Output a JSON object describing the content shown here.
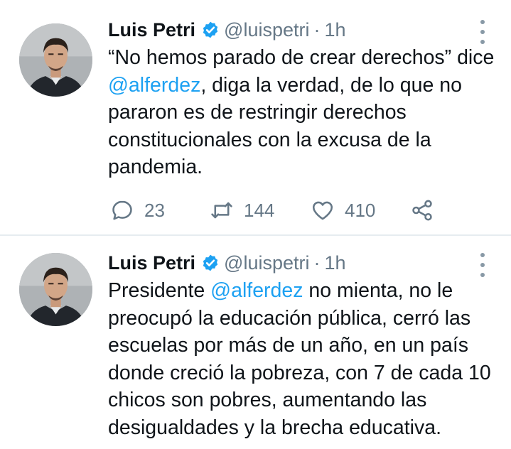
{
  "tweets": [
    {
      "author": "Luis Petri",
      "handle": "@luispetri",
      "separator": "·",
      "time": "1h",
      "text_before": "“No hemos parado de crear derechos” dice ",
      "mention": "@alferdez",
      "text_after": ", diga la verdad, de lo que no pararon es de restringir derechos constitucionales con la excusa de la pandemia.",
      "replies": "23",
      "retweets": "144",
      "likes": "410"
    },
    {
      "author": "Luis Petri",
      "handle": "@luispetri",
      "separator": "·",
      "time": "1h",
      "text_before": "Presidente ",
      "mention": "@alferdez",
      "text_after": " no mienta, no le preocupó la educación pública, cerró las escuelas por más de un año, en un país donde creció la pobreza, con 7 de cada 10 chicos son pobres, aumentando las desigualdades y la brecha educativa."
    }
  ],
  "icons": {
    "verified": "verified-badge-icon",
    "more": "more-vertical-icon",
    "reply": "reply-icon",
    "retweet": "retweet-icon",
    "like": "heart-icon",
    "share": "share-icon"
  },
  "colors": {
    "link": "#1da1f2",
    "secondary_text": "#657786",
    "verified": "#1da1f2",
    "divider": "#e6ecf0"
  }
}
